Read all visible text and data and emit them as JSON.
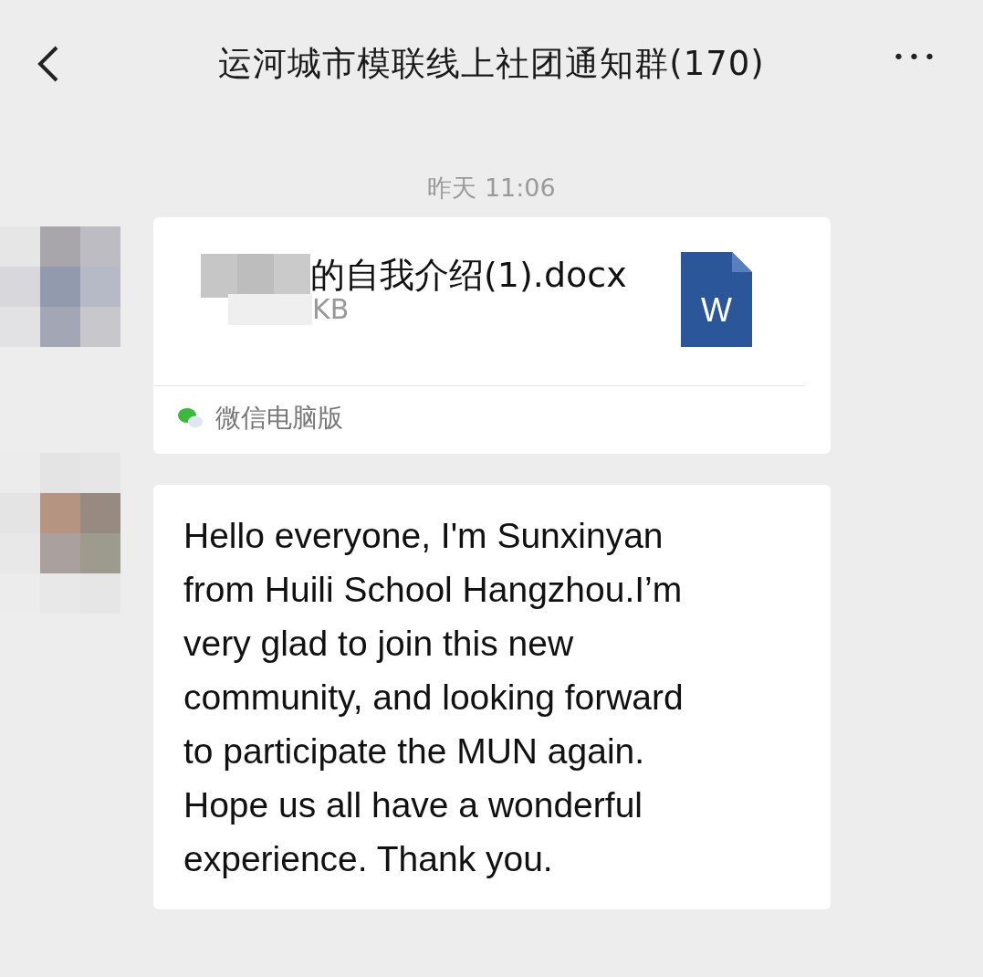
{
  "header": {
    "title": "运河城市模联线上社团通知群(170)",
    "more": "•••"
  },
  "messages": [
    {
      "kind": "timestamp",
      "text": "昨天 11:06"
    },
    {
      "kind": "file",
      "file_name": "的自我介绍(1).docx",
      "file_size": "KB",
      "file_type": "W",
      "source": "微信电脑版"
    },
    {
      "kind": "text",
      "text": "Hello everyone, I'm Sunxinyan\nfrom Huili School Hangzhou.I’m\nvery glad to join this new\ncommunity, and looking forward\nto participate the MUN again.\nHope us all have a wonderful\nexperience. Thank you."
    }
  ]
}
